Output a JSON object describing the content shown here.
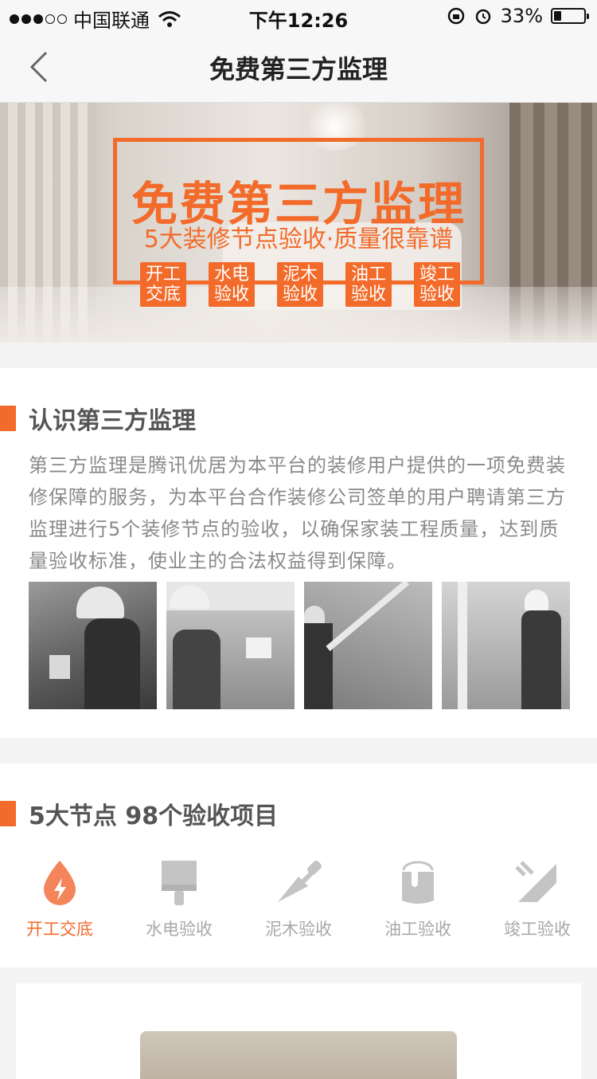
{
  "status_bar": {
    "carrier": "中国联通",
    "time": "下午12:26",
    "battery": "33%",
    "battery_level": 0.33
  },
  "nav": {
    "title": "免费第三方监理",
    "back_icon": "chevron-left-icon"
  },
  "banner": {
    "title": "免费第三方监理",
    "subtitle": "5大装修节点验收·质量很靠谱",
    "tags": [
      {
        "line1": "开工",
        "line2": "交底"
      },
      {
        "line1": "水电",
        "line2": "验收"
      },
      {
        "line1": "泥木",
        "line2": "验收"
      },
      {
        "line1": "油工",
        "line2": "验收"
      },
      {
        "line1": "竣工",
        "line2": "验收"
      }
    ]
  },
  "intro_section": {
    "title": "认识第三方监理",
    "body": "第三方监理是腾讯优居为本平台的装修用户提供的一项免费装修保障的服务，为本平台合作装修公司签单的用户聘请第三方监理进行5个装修节点的验收，以确保家装工程质量，达到质量验收标准，使业主的合法权益得到保障。"
  },
  "nodes_section": {
    "title": "5大节点 98个验收项目",
    "nodes": [
      {
        "label": "开工交底",
        "icon": "flame-icon",
        "active": true
      },
      {
        "label": "水电验收",
        "icon": "paint-brush-icon",
        "active": false
      },
      {
        "label": "泥木验收",
        "icon": "trowel-icon",
        "active": false
      },
      {
        "label": "油工验收",
        "icon": "paint-bucket-icon",
        "active": false
      },
      {
        "label": "竣工验收",
        "icon": "ruler-square-icon",
        "active": false
      }
    ]
  },
  "colors": {
    "accent": "#f26b2b",
    "inactive": "#a8a8a8"
  }
}
